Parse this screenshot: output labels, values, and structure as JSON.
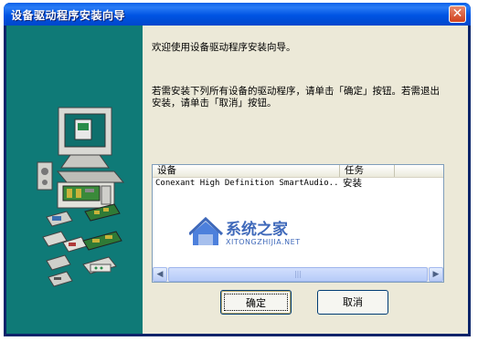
{
  "window": {
    "title": "设备驱动程序安装向导"
  },
  "content": {
    "welcome": "欢迎使用设备驱动程序安装向导。",
    "instruction": "若需安装下列所有设备的驱动程序，请单击「确定」按钮。若需退出安装，请单击「取消」按钮。"
  },
  "device_list": {
    "columns": [
      "设备",
      "任务"
    ],
    "rows": [
      {
        "device": "Conexant High Definition SmartAudio...",
        "task": "安装"
      }
    ]
  },
  "watermark": {
    "brand": "系统之家",
    "url": "XITONGZHIJIA.NET"
  },
  "buttons": {
    "ok": "确定",
    "cancel": "取消"
  },
  "colors": {
    "side_panel": "#0f7a77",
    "title_bar": "#0054e3",
    "dialog_bg": "#ece9d8"
  }
}
